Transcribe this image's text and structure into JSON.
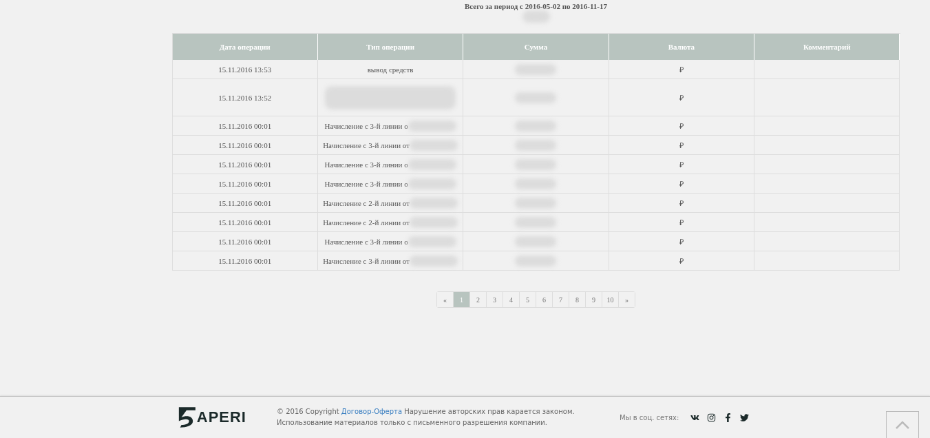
{
  "summary": {
    "title": "Всего за период с 2016-05-02 по 2016-11-17",
    "value_blurred": true
  },
  "table": {
    "columns": [
      "Дата операции",
      "Тип операции",
      "Сумма",
      "Валюта",
      "Комментарий"
    ],
    "rows": [
      {
        "date": "15.11.2016 13:53",
        "type": "вывод средств",
        "type_blurred": false,
        "tall": false,
        "currency": "₽"
      },
      {
        "date": "15.11.2016 13:52",
        "type_blurred": true,
        "tall": true,
        "currency": "₽"
      },
      {
        "date": "15.11.2016 00:01",
        "type": "Начисление с 3-й линии о",
        "type_blurred": true,
        "tall": false,
        "currency": "₽"
      },
      {
        "date": "15.11.2016 00:01",
        "type": "Начисление с 3-й линии от",
        "type_blurred": true,
        "tall": false,
        "currency": "₽"
      },
      {
        "date": "15.11.2016 00:01",
        "type": "Начисление с 3-й линии о",
        "type_blurred": true,
        "tall": false,
        "currency": "₽"
      },
      {
        "date": "15.11.2016 00:01",
        "type": "Начисление с 3-й линии о",
        "type_blurred": true,
        "tall": false,
        "currency": "₽"
      },
      {
        "date": "15.11.2016 00:01",
        "type": "Начисление с 2-й линии от",
        "type_blurred": true,
        "tall": false,
        "currency": "₽"
      },
      {
        "date": "15.11.2016 00:01",
        "type": "Начисление с 2-й линии от",
        "type_blurred": true,
        "tall": false,
        "currency": "₽"
      },
      {
        "date": "15.11.2016 00:01",
        "type": "Начисление с 3-й линии о",
        "type_blurred": true,
        "tall": false,
        "currency": "₽"
      },
      {
        "date": "15.11.2016 00:01",
        "type": "Начисление с 3-й линии от",
        "type_blurred": true,
        "tall": false,
        "currency": "₽"
      }
    ]
  },
  "pagination": [
    {
      "label": "«",
      "selected": false
    },
    {
      "label": "1",
      "selected": true
    },
    {
      "label": "2",
      "selected": false
    },
    {
      "label": "3",
      "selected": false
    },
    {
      "label": "4",
      "selected": false
    },
    {
      "label": "5",
      "selected": false
    },
    {
      "label": "6",
      "selected": false
    },
    {
      "label": "7",
      "selected": false
    },
    {
      "label": "8",
      "selected": false
    },
    {
      "label": "9",
      "selected": false
    },
    {
      "label": "10",
      "selected": false
    },
    {
      "label": "»",
      "selected": false
    }
  ],
  "footer": {
    "logo": "APERI",
    "copyright": "© 2016 Copyright",
    "link": "Договор-Оферта",
    "notice": "Нарушение авторских прав карается законом.",
    "notice2": "Использование материалов только с письменного разрешения компании.",
    "social_label": "Мы в соц. сетях:",
    "social": [
      {
        "kind": "vk"
      },
      {
        "kind": "instagram"
      },
      {
        "kind": "facebook"
      },
      {
        "kind": "twitter"
      }
    ]
  }
}
